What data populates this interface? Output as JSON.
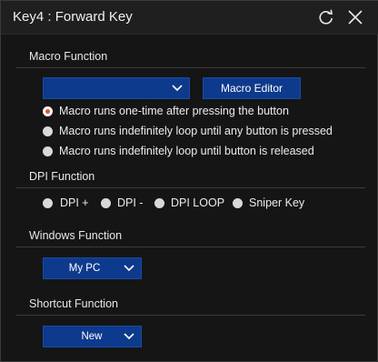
{
  "window": {
    "title": "Key4 : Forward Key"
  },
  "macro": {
    "section_title": "Macro Function",
    "dropdown_value": "",
    "editor_button": "Macro Editor",
    "options": [
      {
        "label": "Macro runs one-time after pressing the button",
        "selected": true
      },
      {
        "label": "Macro runs indefinitely loop until any button is pressed",
        "selected": false
      },
      {
        "label": "Macro runs indefinitely loop until button is released",
        "selected": false
      }
    ]
  },
  "dpi": {
    "section_title": "DPI Function",
    "options": [
      {
        "label": "DPI +"
      },
      {
        "label": "DPI -"
      },
      {
        "label": "DPI LOOP"
      },
      {
        "label": "Sniper Key"
      }
    ]
  },
  "windows_fn": {
    "section_title": "Windows Function",
    "dropdown_value": "My PC"
  },
  "shortcut_fn": {
    "section_title": "Shortcut Function",
    "dropdown_value": "New"
  },
  "colors": {
    "accent": "#0d3a8c",
    "selected_radio": "#e0542d",
    "background": "#151515"
  }
}
